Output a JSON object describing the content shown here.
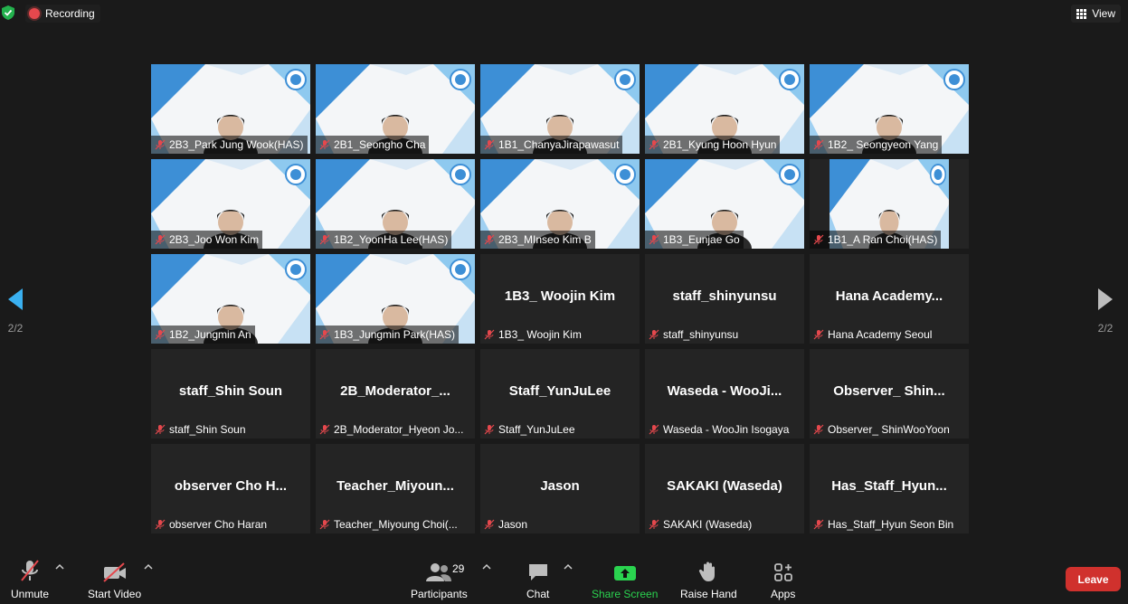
{
  "topbar": {
    "recording_label": "Recording",
    "view_label": "View"
  },
  "pagination": {
    "left_label": "2/2",
    "right_label": "2/2"
  },
  "tiles": [
    {
      "type": "video",
      "tag": "2B3_Park Jung Wook(HAS)"
    },
    {
      "type": "video",
      "tag": "2B1_Seongho Cha"
    },
    {
      "type": "video",
      "tag": "1B1_ChanyaJirapawasut"
    },
    {
      "type": "video",
      "tag": "2B1_Kyung Hoon Hyun"
    },
    {
      "type": "video",
      "tag": "1B2_ Seongyeon Yang"
    },
    {
      "type": "video",
      "tag": "2B3_Joo Won Kim"
    },
    {
      "type": "video",
      "tag": "1B2_YoonHa Lee(HAS)"
    },
    {
      "type": "video",
      "tag": "2B3_MInseo Kim B"
    },
    {
      "type": "video",
      "tag": "1B3_Eunjae Go"
    },
    {
      "type": "video",
      "narrow": true,
      "tag": "1B1_A Ran Choi(HAS)"
    },
    {
      "type": "video",
      "tag": "1B2_Jungmin An"
    },
    {
      "type": "video",
      "tag": "1B3_Jungmin Park(HAS)"
    },
    {
      "type": "name",
      "center": "1B3_ Woojin Kim",
      "tag": "1B3_ Woojin Kim"
    },
    {
      "type": "name",
      "center": "staff_shinyunsu",
      "tag": "staff_shinyunsu"
    },
    {
      "type": "name",
      "center": "Hana Academy...",
      "tag": "Hana Academy Seoul"
    },
    {
      "type": "name",
      "center": "staff_Shin Soun",
      "tag": "staff_Shin Soun"
    },
    {
      "type": "name",
      "center": "2B_Moderator_...",
      "tag": "2B_Moderator_Hyeon Jo..."
    },
    {
      "type": "name",
      "center": "Staff_YunJuLee",
      "tag": "Staff_YunJuLee"
    },
    {
      "type": "name",
      "center": "Waseda - WooJi...",
      "tag": "Waseda - WooJin Isogaya"
    },
    {
      "type": "name",
      "center": "Observer_ Shin...",
      "tag": "Observer_ ShinWooYoon"
    },
    {
      "type": "name",
      "center": "observer Cho H...",
      "tag": "observer Cho Haran"
    },
    {
      "type": "name",
      "center": "Teacher_Miyoun...",
      "tag": "Teacher_Miyoung Choi(..."
    },
    {
      "type": "name",
      "center": "Jason",
      "tag": "Jason"
    },
    {
      "type": "name",
      "center": "SAKAKI (Waseda)",
      "tag": "SAKAKI (Waseda)"
    },
    {
      "type": "name",
      "center": "Has_Staff_Hyun...",
      "tag": "Has_Staff_Hyun Seon Bin"
    }
  ],
  "toolbar": {
    "unmute": "Unmute",
    "start_video": "Start Video",
    "participants": "Participants",
    "participant_count": "29",
    "chat": "Chat",
    "share_screen": "Share Screen",
    "raise_hand": "Raise Hand",
    "apps": "Apps",
    "leave": "Leave"
  },
  "colors": {
    "share_green": "#2ad34f",
    "leave_red": "#d0312d",
    "arrow_blue": "#3ab0f0",
    "mic_red": "#e5484d"
  }
}
